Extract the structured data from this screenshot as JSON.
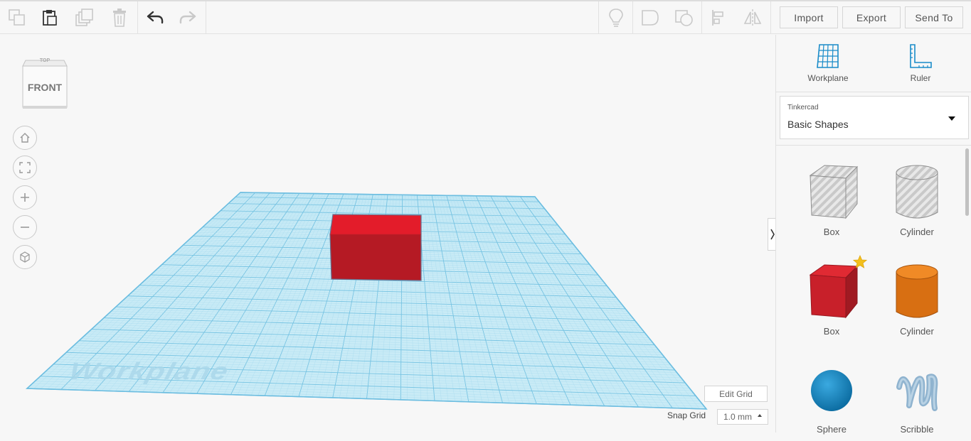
{
  "toolbar": {
    "icons": [
      "copy-icon",
      "paste-icon",
      "duplicate-icon",
      "delete-icon",
      "undo-icon",
      "redo-icon",
      "lightbulb-icon",
      "shape-solid-icon",
      "shape-hole-icon",
      "align-icon",
      "mirror-icon"
    ],
    "import_label": "Import",
    "export_label": "Export",
    "send_to_label": "Send To"
  },
  "viewcube": {
    "front_label": "FRONT",
    "top_label": "TOP"
  },
  "nav": [
    "home-view-icon",
    "fit-view-icon",
    "zoom-in-icon",
    "zoom-out-icon",
    "ortho-view-icon"
  ],
  "workplane": {
    "watermark": "Workplane",
    "edit_grid_label": "Edit Grid",
    "snap_grid_label": "Snap Grid",
    "snap_grid_value": "1.0 mm"
  },
  "panel": {
    "workplane_label": "Workplane",
    "ruler_label": "Ruler",
    "library_source": "Tinkercad",
    "library_name": "Basic Shapes",
    "shapes": [
      {
        "label": "Box",
        "style": "hole"
      },
      {
        "label": "Cylinder",
        "style": "hole"
      },
      {
        "label": "Box",
        "style": "solid",
        "color": "#c8202a"
      },
      {
        "label": "Cylinder",
        "style": "solid",
        "color": "#e07a1e"
      },
      {
        "label": "Sphere",
        "style": "solid",
        "color": "#1a8cc9"
      },
      {
        "label": "Scribble",
        "style": "solid",
        "color": "#8fb3cf"
      }
    ]
  },
  "colors": {
    "grid": "#8fd0ea",
    "box": "#c8202a",
    "accent": "#1a8cc9"
  }
}
